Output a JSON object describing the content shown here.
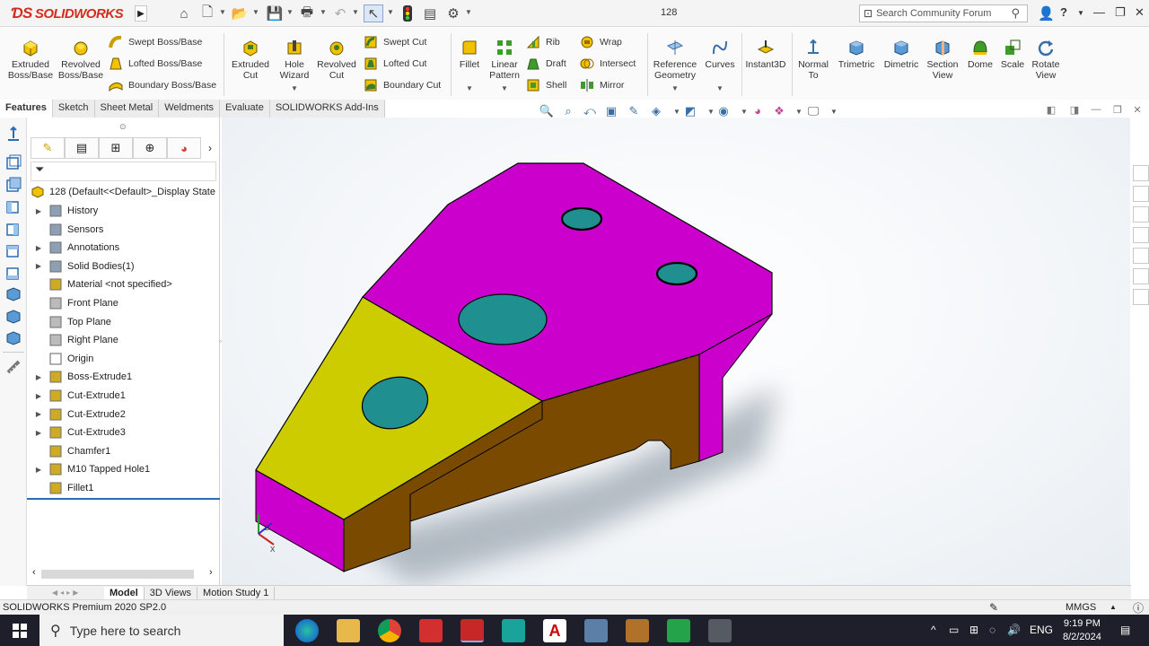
{
  "titlebar": {
    "logo_text": "SOLIDWORKS",
    "doc_title": "128",
    "search_placeholder": "Search Community Forum",
    "help": "?"
  },
  "ribbon": {
    "extruded_boss": "Extruded\nBoss/Base",
    "revolved_boss": "Revolved\nBoss/Base",
    "swept_boss": "Swept Boss/Base",
    "lofted_boss": "Lofted Boss/Base",
    "boundary_boss": "Boundary Boss/Base",
    "extruded_cut": "Extruded\nCut",
    "hole_wizard": "Hole\nWizard",
    "revolved_cut": "Revolved\nCut",
    "swept_cut": "Swept Cut",
    "lofted_cut": "Lofted Cut",
    "boundary_cut": "Boundary Cut",
    "fillet": "Fillet",
    "linear_pattern": "Linear\nPattern",
    "rib": "Rib",
    "draft": "Draft",
    "shell": "Shell",
    "wrap": "Wrap",
    "intersect": "Intersect",
    "mirror": "Mirror",
    "reference_geometry": "Reference\nGeometry",
    "curves": "Curves",
    "instant3d": "Instant3D",
    "normal_to": "Normal\nTo",
    "trimetric": "Trimetric",
    "dimetric": "Dimetric",
    "section_view": "Section\nView",
    "dome": "Dome",
    "scale": "Scale",
    "rotate_view": "Rotate\nView"
  },
  "tabs": [
    "Features",
    "Sketch",
    "Sheet Metal",
    "Weldments",
    "Evaluate",
    "SOLIDWORKS Add-Ins"
  ],
  "tree": {
    "root": "128  (Default<<Default>_Display State",
    "items": [
      {
        "label": "History",
        "expand": true
      },
      {
        "label": "Sensors",
        "expand": false
      },
      {
        "label": "Annotations",
        "expand": true
      },
      {
        "label": "Solid Bodies(1)",
        "expand": true
      },
      {
        "label": "Material <not specified>",
        "expand": false
      },
      {
        "label": "Front Plane",
        "expand": false
      },
      {
        "label": "Top Plane",
        "expand": false
      },
      {
        "label": "Right Plane",
        "expand": false
      },
      {
        "label": "Origin",
        "expand": false
      },
      {
        "label": "Boss-Extrude1",
        "expand": true
      },
      {
        "label": "Cut-Extrude1",
        "expand": true
      },
      {
        "label": "Cut-Extrude2",
        "expand": true
      },
      {
        "label": "Cut-Extrude3",
        "expand": true
      },
      {
        "label": "Chamfer1",
        "expand": false
      },
      {
        "label": "M10 Tapped Hole1",
        "expand": true
      },
      {
        "label": "Fillet1",
        "expand": false
      }
    ]
  },
  "bottom_tabs": [
    "Model",
    "3D Views",
    "Motion Study 1"
  ],
  "status": {
    "product": "SOLIDWORKS Premium 2020 SP2.0",
    "units": "MMGS"
  },
  "taskbar": {
    "search_placeholder": "Type here to search",
    "lang": "ENG",
    "time": "9:19 PM",
    "date": "8/2/2024"
  },
  "colors": {
    "face_top": "#cc00cc",
    "face_yellow": "#cccc00",
    "face_brown": "#7a4a00",
    "hole": "#1f8f8f",
    "accent": "#2a6db5"
  }
}
